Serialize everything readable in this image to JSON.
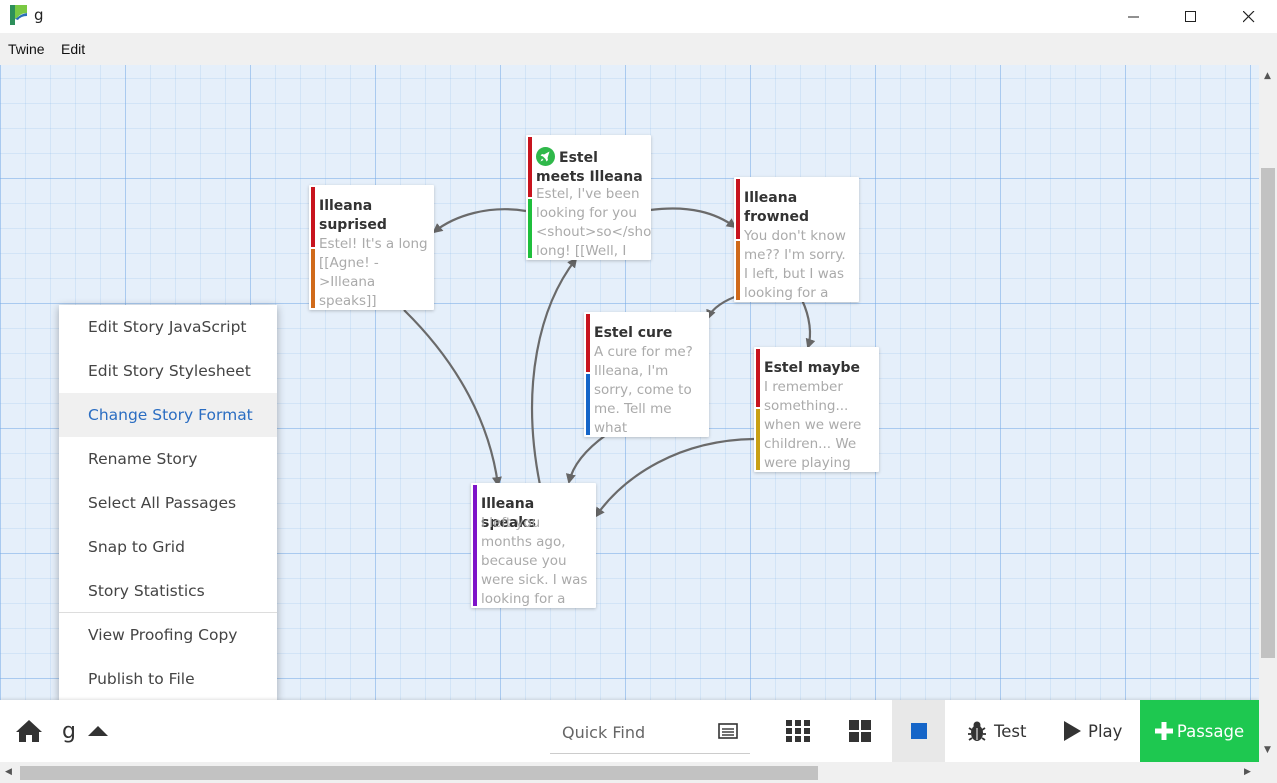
{
  "window": {
    "title": "g",
    "menu": [
      "Twine",
      "Edit"
    ]
  },
  "passages": [
    {
      "id": "estel-meets-illeana",
      "title": "Estel meets Illeana",
      "excerpt": "Estel, I've been\nlooking for you\n<shout>so</shout>\nlong! [[Well, I",
      "start": true,
      "tags": [
        "#c8141e",
        "#1fbf3c"
      ]
    },
    {
      "id": "illeana-suprised",
      "title": "Illeana suprised",
      "excerpt": "Estel! It's a long\n[[Agne! -\n>Illeana\nspeaks]]",
      "start": false,
      "tags": [
        "#c8141e",
        "#d06a1a"
      ]
    },
    {
      "id": "illeana-frowned",
      "title": "Illeana frowned",
      "excerpt": "You don't know\nme?? I'm sorry.\nI left, but I was\nlooking for a",
      "start": false,
      "tags": [
        "#c8141e",
        "#d06a1a"
      ]
    },
    {
      "id": "estel-cure",
      "title": "Estel cure",
      "excerpt": "A cure for me?\nIlleana, I'm\nsorry, come to\nme. Tell me\nwhat",
      "start": false,
      "tags": [
        "#c8141e",
        "#1565c8"
      ]
    },
    {
      "id": "estel-maybe",
      "title": "Estel maybe",
      "excerpt": "I remember\nsomething...\nwhen we were\nchildren... We\nwere playing",
      "start": false,
      "tags": [
        "#c8141e",
        "#c8a014"
      ]
    },
    {
      "id": "illeana-speaks",
      "title": "Illeana speaks",
      "excerpt": "I left you\nmonths ago,\nbecause you\nwere sick. I was\nlooking for a",
      "start": false,
      "tags": [
        "#7e14c8"
      ]
    }
  ],
  "context_menu": {
    "items": [
      {
        "label": "Edit Story JavaScript",
        "active": false
      },
      {
        "label": "Edit Story Stylesheet",
        "active": false
      },
      {
        "label": "Change Story Format",
        "active": true
      },
      {
        "label": "Rename Story",
        "active": false
      },
      {
        "label": "Select All Passages",
        "active": false
      },
      {
        "label": "Snap to Grid",
        "active": false
      },
      {
        "label": "Story Statistics",
        "active": false
      },
      {
        "label": "View Proofing Copy",
        "active": false
      },
      {
        "label": "Publish to File",
        "active": false
      }
    ]
  },
  "toolbar": {
    "story_name": "g",
    "quick_find_placeholder": "Quick Find",
    "test_label": "Test",
    "play_label": "Play",
    "passage_label": "Passage",
    "accent": "#1ec850"
  }
}
